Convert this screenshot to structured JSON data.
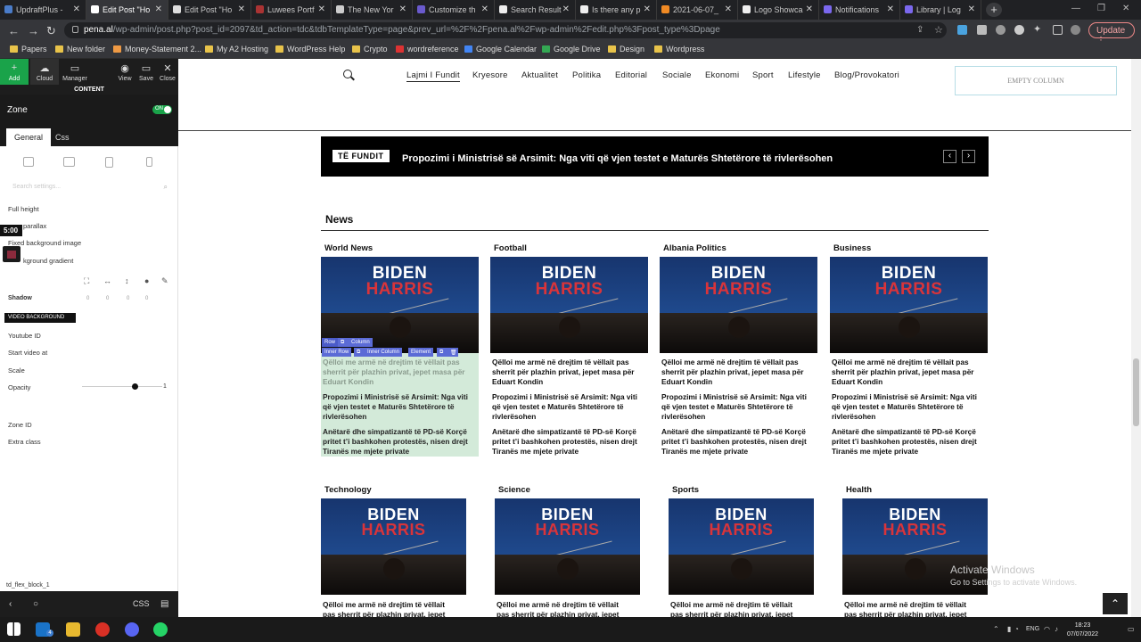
{
  "browser": {
    "tabs": [
      {
        "label": "UpdraftPlus -",
        "active": false
      },
      {
        "label": "Edit Post \"Ho",
        "active": true
      },
      {
        "label": "Edit Post \"Ho",
        "active": false
      },
      {
        "label": "Luwees Portf",
        "active": false
      },
      {
        "label": "The New Yor",
        "active": false
      },
      {
        "label": "Customize th",
        "active": false
      },
      {
        "label": "Search Result",
        "active": false
      },
      {
        "label": "Is there any p",
        "active": false
      },
      {
        "label": "2021-06-07_",
        "active": false
      },
      {
        "label": "Logo Showca",
        "active": false
      },
      {
        "label": "Notifications",
        "active": false
      },
      {
        "label": "Library | Log",
        "active": false
      }
    ],
    "url_host": "pena.al",
    "url_path": "/wp-admin/post.php?post_id=2097&td_action=tdc&tdbTemplateType=page&prev_url=%2F%2Fpena.al%2Fwp-admin%2Fedit.php%3Fpost_type%3Dpage",
    "update_label": "Update",
    "bookmarks": [
      "Papers",
      "New folder",
      "Money-Statement 2...",
      "My A2 Hosting",
      "WordPress Help",
      "Crypto",
      "wordreference",
      "Google Calendar",
      "Google Drive",
      "Design",
      "Wordpress"
    ]
  },
  "editor": {
    "toolbar": [
      {
        "label": "Add",
        "icon": "plus-icon"
      },
      {
        "label": "Cloud",
        "icon": "cloud-icon"
      },
      {
        "label": "Manager",
        "icon": "manager-icon"
      },
      {
        "label": "View",
        "icon": "eye-icon"
      },
      {
        "label": "Save",
        "icon": "save-icon"
      },
      {
        "label": "Close",
        "icon": "close-icon"
      }
    ],
    "content_label": "CONTENT",
    "zone_title": "Zone",
    "zone_toggle": "ON",
    "tabs": [
      "General",
      "Css"
    ],
    "search_placeholder": "Search settings...",
    "settings": {
      "full_height": "Full height",
      "parallax": "parallax",
      "fixed_bg": "Fixed background image",
      "bg_gradient": "kground gradient",
      "shadow": "Shadow",
      "zero": "0",
      "video_bg": "VIDEO BACKGROUND",
      "youtube_id": "Youtube ID",
      "start_video": "Start video at",
      "scale": "Scale",
      "opacity": "Opacity",
      "opacity_value": "1",
      "zone_id": "Zone ID",
      "extra_class": "Extra class"
    },
    "time_badge": "5:00",
    "flex_block": "td_flex_block_1",
    "bottom_css": "CSS"
  },
  "site": {
    "nav": [
      "Lajmi I Fundit",
      "Kryesore",
      "Aktualitet",
      "Politika",
      "Editorial",
      "Sociale",
      "Ekonomi",
      "Sport",
      "Lifestyle",
      "Blog/Provokatori"
    ],
    "empty_column": "EMPTY COLUMN",
    "ticker_label": "TË FUNDIT",
    "ticker_title": "Propozimi i Ministrisë së Arsimit: Nga viti që vjen testet e Maturës Shtetërore të rivlerësohen",
    "news_heading": "News",
    "thumb_text": {
      "line1": "BIDEN",
      "line2": "HARRIS"
    },
    "headlines": [
      "Qëlloi me armë në drejtim të vëllait pas sherrit për plazhin privat, jepet masa për Eduart Kondin",
      "Propozimi i Ministrisë së Arsimit: Nga viti që vjen testet e Maturës Shtetërore të rivlerësohen",
      "Anëtarë dhe simpatizantë të PD-së Korçë pritet t’i bashkohen protestës, nisen drejt Tiranës me mjete private"
    ],
    "row1": [
      "World News",
      "Football",
      "Albania Politics",
      "Business"
    ],
    "row2": [
      "Technology",
      "Science",
      "Sports",
      "Health"
    ],
    "row2_headline_line1": "Qëlloi me armë në drejtim të vëllait",
    "row2_headline_line2": "pas sherrit për plazhin privat, jepet",
    "edit_labels": {
      "row": "Row",
      "column": "Column",
      "inner_row": "Inner Row",
      "inner_column": "Inner Column",
      "element": "Element"
    }
  },
  "watermark": {
    "line1": "Activate Windows",
    "line2": "Go to Settings to activate Windows."
  },
  "taskbar": {
    "lang": "ENG",
    "time": "18:23",
    "date": "07/07/2022",
    "mail_badge": "4"
  }
}
